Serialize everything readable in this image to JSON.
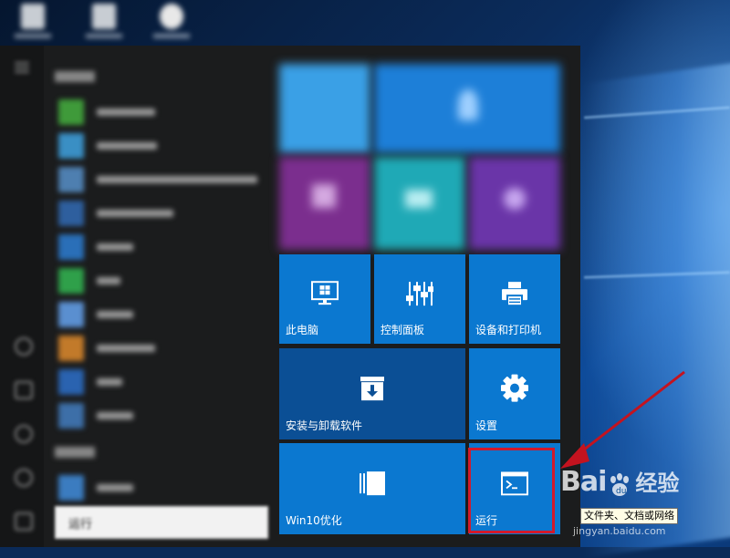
{
  "desktop": {
    "icons_count": 3
  },
  "start_menu": {
    "search": {
      "value": "运行"
    },
    "tiles": {
      "this_pc": {
        "label": "此电脑",
        "icon": "monitor-windows-icon"
      },
      "control_panel": {
        "label": "控制面板",
        "icon": "sliders-icon"
      },
      "devices_printers": {
        "label": "设备和打印机",
        "icon": "printer-icon"
      },
      "install_uninstall": {
        "label": "安装与卸载软件",
        "icon": "download-box-icon"
      },
      "settings": {
        "label": "设置",
        "icon": "gear-icon"
      },
      "win10_optimize": {
        "label": "Win10优化",
        "icon": "window-panel-icon"
      },
      "run": {
        "label": "运行",
        "icon": "terminal-icon"
      }
    }
  },
  "tooltip": {
    "text": "文件夹、文档或网络"
  },
  "watermark": {
    "brand": "Bai",
    "brand_tail": "经验",
    "url": "jingyan.baidu.com"
  },
  "colors": {
    "tile": "#0b78d0",
    "tile_dark": "#0b4f95",
    "highlight": "#d2192b",
    "arrow": "#c4131f"
  }
}
